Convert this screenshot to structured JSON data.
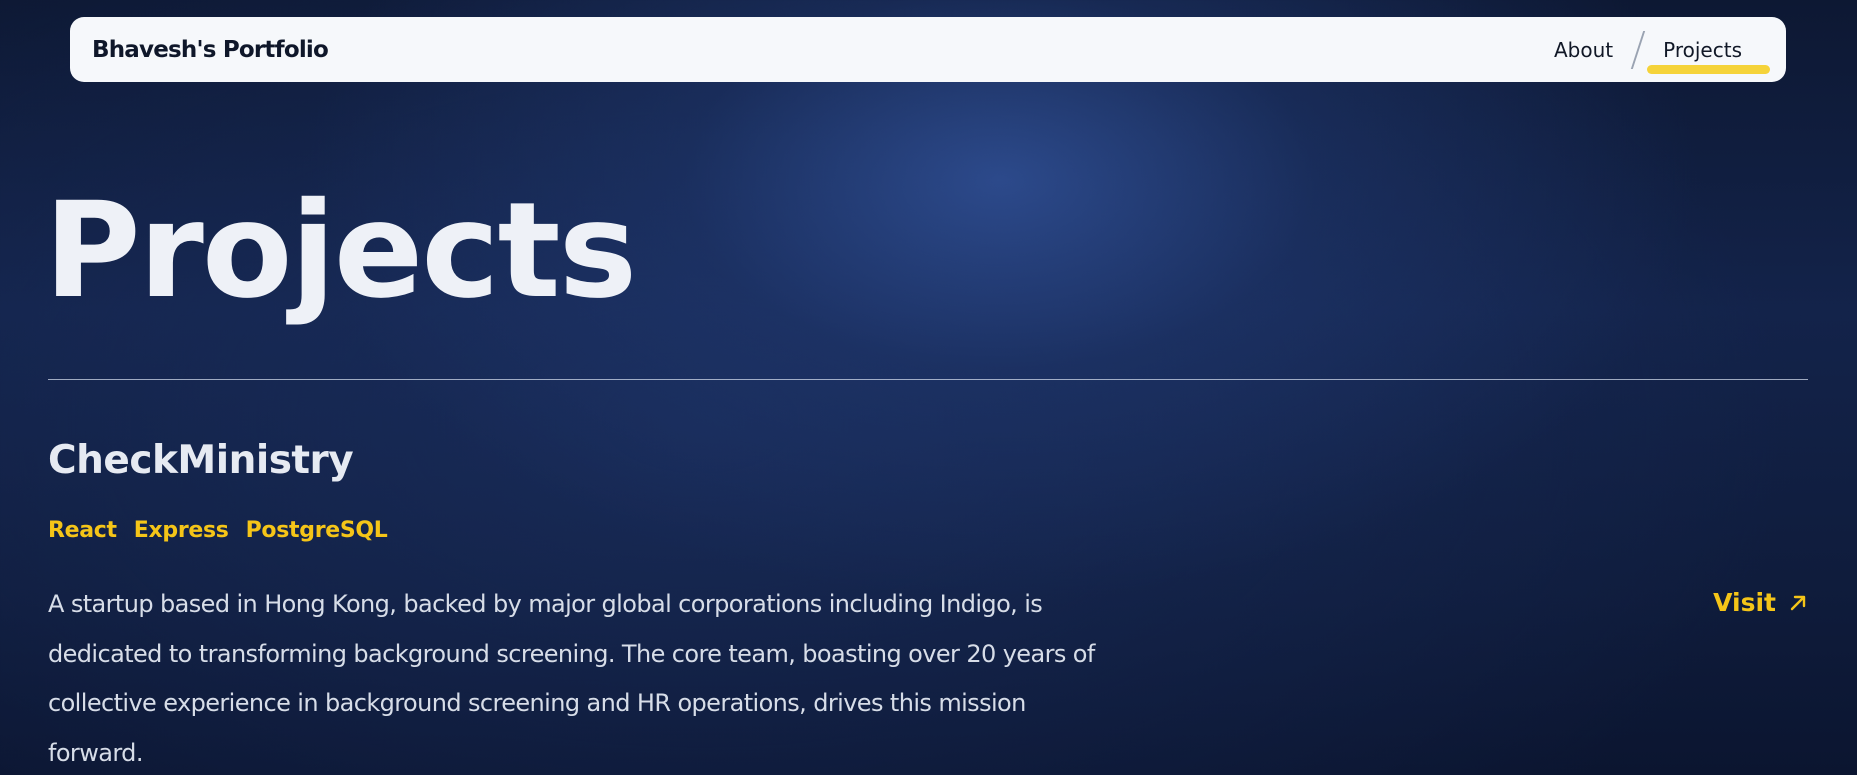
{
  "navbar": {
    "brand": "Bhavesh's Portfolio",
    "links": [
      {
        "label": "About",
        "active": false
      },
      {
        "label": "Projects",
        "active": true
      }
    ],
    "accent_color": "#f5d33a"
  },
  "page": {
    "title": "Projects"
  },
  "projects": [
    {
      "name": "CheckMinistry",
      "tags": [
        "React",
        "Express",
        "PostgreSQL"
      ],
      "description": "A startup based in Hong Kong, backed by major global corporations including Indigo, is dedicated to transforming background screening. The core team, boasting over 20 years of collective experience in background screening and HR operations, drives this mission forward.",
      "link_label": "Visit",
      "link_icon": "arrow-up-right-icon"
    }
  ],
  "colors": {
    "tag": "#f5c518",
    "background": "#13234a"
  }
}
